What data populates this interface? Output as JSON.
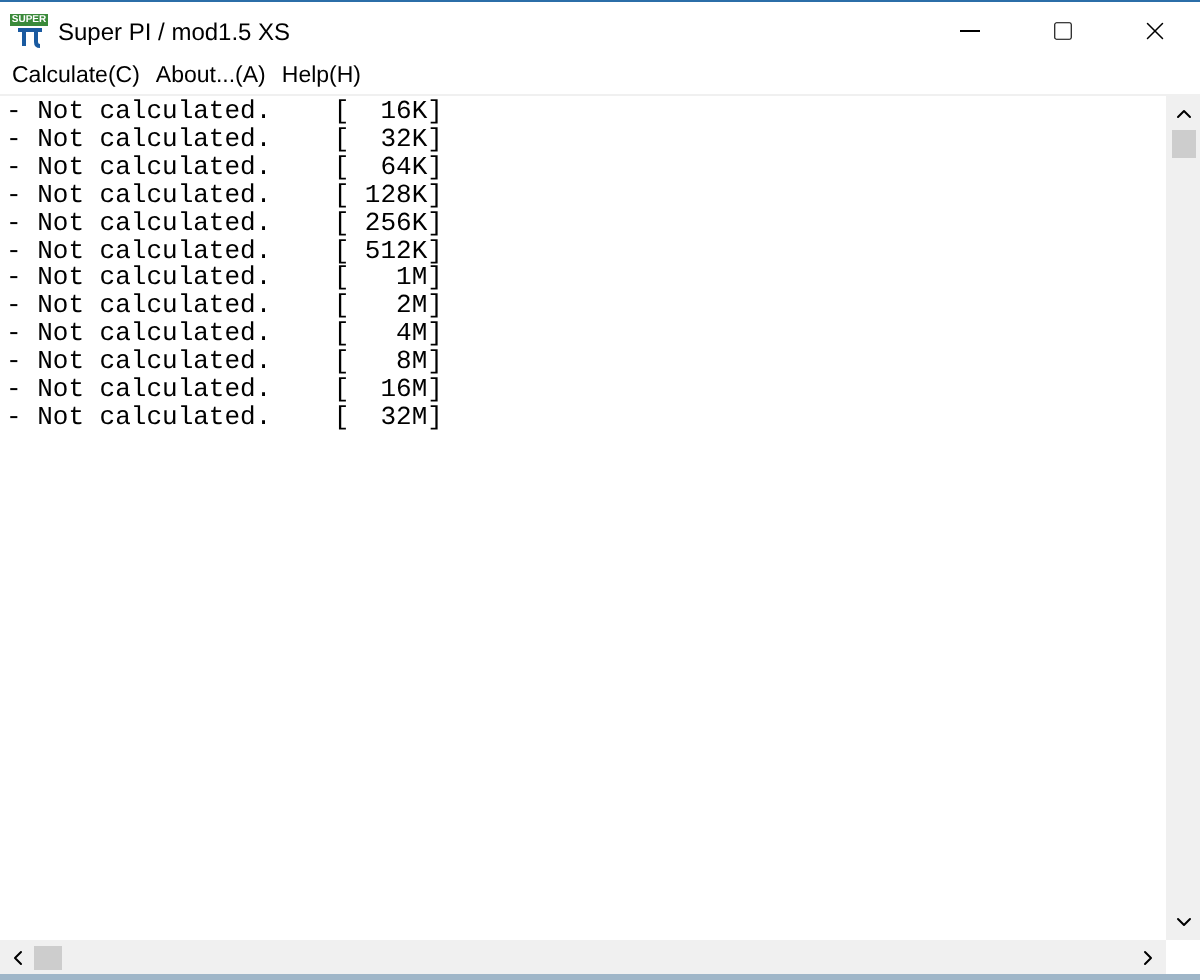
{
  "window": {
    "title": "Super PI / mod1.5 XS",
    "icon_text": "SUPER"
  },
  "menu": [
    "Calculate(C)",
    "About...(A)",
    "Help(H)"
  ],
  "lines": [
    "- Not calculated.    [  16K]",
    "- Not calculated.    [  32K]",
    "- Not calculated.    [  64K]",
    "- Not calculated.    [ 128K]",
    "- Not calculated.    [ 256K]",
    "- Not calculated.    [ 512K]",
    "- Not calculated.    [   1M]",
    "- Not calculated.    [   2M]",
    "- Not calculated.    [   4M]",
    "- Not calculated.    [   8M]",
    "- Not calculated.    [  16M]",
    "- Not calculated.    [  32M]"
  ]
}
